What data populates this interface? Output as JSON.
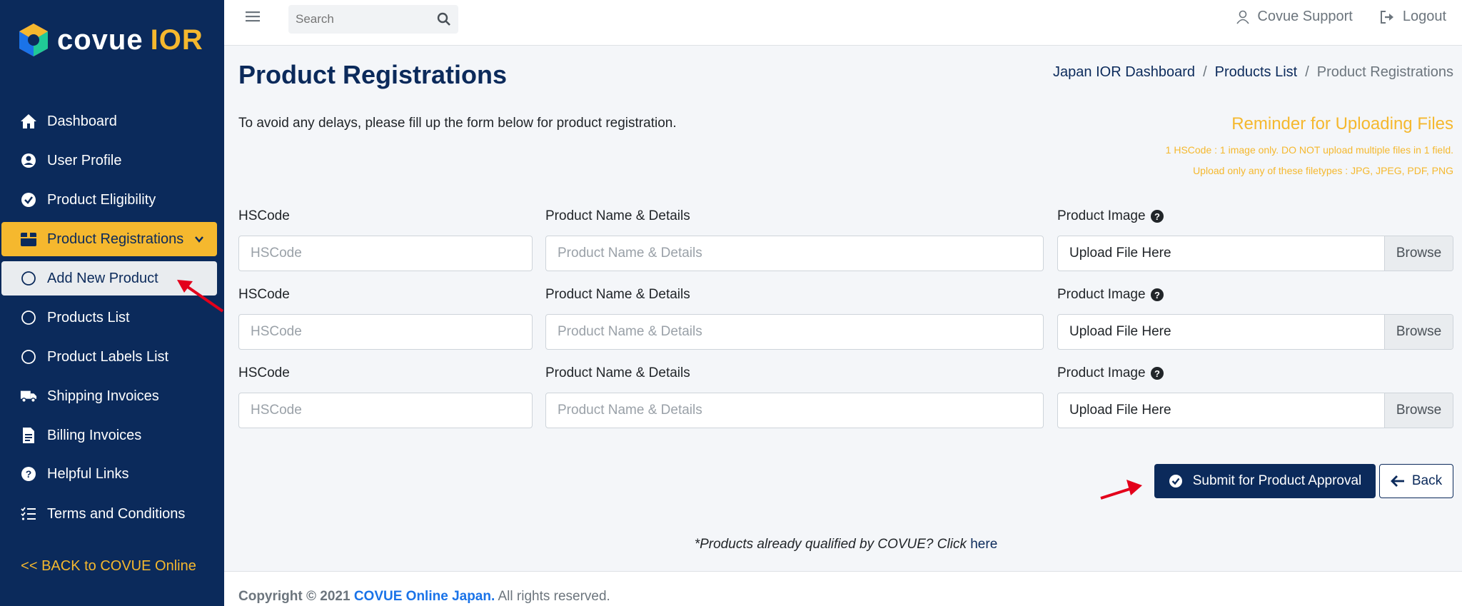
{
  "brand": {
    "name": "covue",
    "suffix": "IOR"
  },
  "sidebar": {
    "items": [
      {
        "label": "Dashboard",
        "icon": "home-icon"
      },
      {
        "label": "User Profile",
        "icon": "user-circle-icon"
      },
      {
        "label": "Product Eligibility",
        "icon": "check-circle-icon"
      },
      {
        "label": "Product Registrations",
        "icon": "box-icon"
      },
      {
        "label": "Add New Product",
        "icon": "circle-icon"
      },
      {
        "label": "Products List",
        "icon": "circle-icon"
      },
      {
        "label": "Product Labels List",
        "icon": "circle-icon"
      },
      {
        "label": "Shipping Invoices",
        "icon": "truck-icon"
      },
      {
        "label": "Billing Invoices",
        "icon": "invoice-icon"
      },
      {
        "label": "Helpful Links",
        "icon": "question-circle-icon"
      },
      {
        "label": "Terms and Conditions",
        "icon": "list-check-icon"
      }
    ],
    "back_link": "<< BACK to COVUE Online"
  },
  "topbar": {
    "search_placeholder": "Search",
    "support_label": "Covue Support",
    "logout_label": "Logout"
  },
  "page": {
    "title": "Product Registrations",
    "breadcrumb": [
      "Japan IOR Dashboard",
      "Products List",
      "Product Registrations"
    ],
    "intro": "To avoid any delays, please fill up the form below for product registration.",
    "reminder": {
      "title": "Reminder for Uploading Files",
      "line1": "1 HSCode : 1 image only. DO NOT upload multiple files in 1 field.",
      "line2": "Upload only any of these filetypes : JPG, JPEG, PDF, PNG"
    }
  },
  "form": {
    "hscode_label": "HSCode",
    "hscode_placeholder": "HSCode",
    "name_label": "Product Name & Details",
    "name_placeholder": "Product Name & Details",
    "image_label": "Product Image",
    "upload_text": "Upload File Here",
    "browse_label": "Browse"
  },
  "actions": {
    "submit_label": "Submit for Product Approval",
    "back_label": "Back"
  },
  "qualified": {
    "text": "*Products already qualified by COVUE? Click ",
    "link": "here"
  },
  "footer": {
    "copyright": "Copyright © 2021 ",
    "company": "COVUE Online Japan.",
    "rights": " All rights reserved."
  },
  "colors": {
    "navy": "#0b2a5b",
    "accent": "#f5b82e",
    "link": "#1a73e8"
  }
}
